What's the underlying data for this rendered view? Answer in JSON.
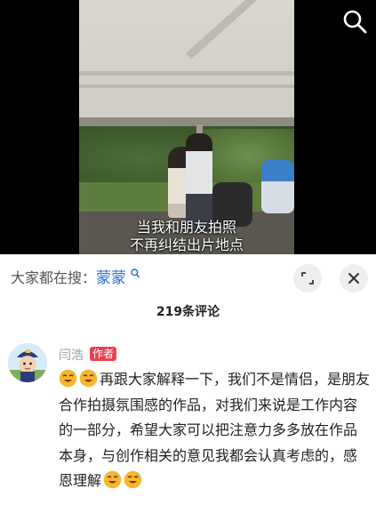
{
  "video": {
    "caption_line1": "当我和朋友拍照",
    "caption_line2": "不再纠结出片地点",
    "search_icon": "search-icon"
  },
  "panel": {
    "trend_prefix": "大家都在搜：",
    "trend_term": "蒙蒙",
    "trend_icon": "search-icon",
    "expand_icon": "expand-icon",
    "close_icon": "close-icon",
    "comment_count": "219条评论"
  },
  "comment": {
    "author": "闫浩",
    "badge": "作者",
    "text_part1": "再跟大家解释一下，我们不是情侣，是朋友合作拍摄氛围感的作品，对我们来说是工作内容的一部分，希望大家可以把注意力多多放在作品本身，与创作相关的意见我都会认真考虑的，感恩理解",
    "emoji": "sweat-smile-emoji"
  },
  "colors": {
    "link_blue": "#2e6fd0",
    "badge_red": "#e8414f",
    "muted_gray": "#999999"
  }
}
